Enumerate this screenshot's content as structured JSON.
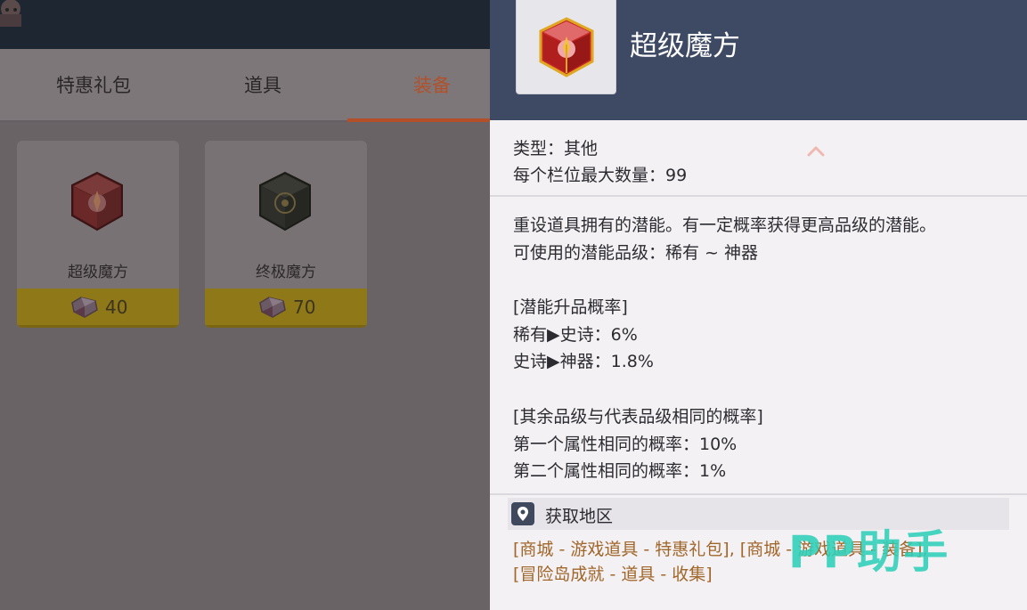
{
  "tabs": [
    {
      "label": "特惠礼包"
    },
    {
      "label": "道具"
    },
    {
      "label": "装备"
    }
  ],
  "items": [
    {
      "name": "超级魔方",
      "price": "40"
    },
    {
      "name": "终极魔方",
      "price": "70"
    }
  ],
  "detail": {
    "title": "超级魔方",
    "type": "类型：其他",
    "max_stack": "每个栏位最大数量：99",
    "desc_lines": [
      "重设道具拥有的潜能。有一定概率获得更高品级的潜能。",
      "可使用的潜能品级：稀有 ~ 神器",
      "",
      "[潜能升品概率]",
      "稀有▶史诗：6%",
      "史诗▶神器：1.8%",
      "",
      "[其余品级与代表品级相同的概率]",
      "第一个属性相同的概率：10%",
      "第二个属性相同的概率：1%"
    ],
    "source_title": "获取地区",
    "source_lines": [
      "[商城 - 游戏道具 - 特惠礼包], [商城 - 游戏道具 - 装备],",
      "[冒险岛成就 - 道具 - 收集]"
    ]
  },
  "watermark": "PP助手",
  "colors": {
    "active_tab": "#b3502a",
    "panel_header": "#3e4a63",
    "source_link": "#a0662a",
    "watermark": "#2fd0b8"
  },
  "icons": [
    "super-cube-icon",
    "ultimate-cube-icon",
    "gem-currency-icon",
    "location-pin-icon",
    "chevron-up-icon"
  ]
}
